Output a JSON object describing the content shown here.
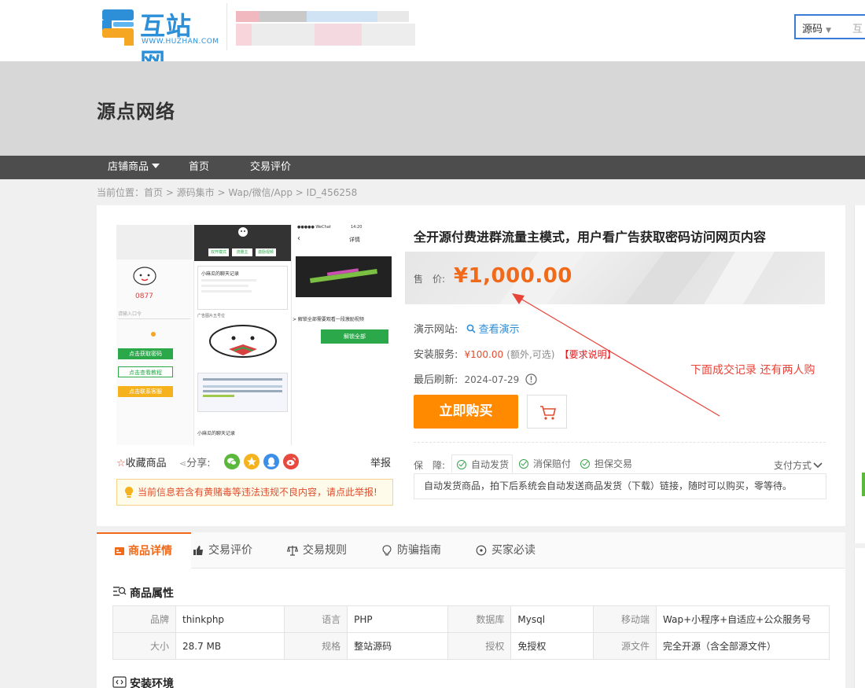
{
  "header": {
    "logo_text": "互站网",
    "logo_url": "WWW.HUZHAN.COM",
    "search_type": "源码",
    "search_placeholder": "互"
  },
  "shop": {
    "name": "源点网络"
  },
  "nav": [
    {
      "label": "店铺商品",
      "dropdown": true
    },
    {
      "label": "首页"
    },
    {
      "label": "交易评价"
    }
  ],
  "breadcrumb": "当前位置：首页 > 源码集市 > Wap/微信/App > ID_456258",
  "gallery": {
    "left_number": "0877",
    "left_hint": "请输入口令",
    "left_btn1": "点击获取密码",
    "left_btn2": "点击查看教程",
    "left_btn3": "点击联系客服",
    "mid_tab1": "双开模式",
    "mid_tab2": "流量主",
    "mid_tab3": "激励视频",
    "mid_list_title": "小麻瓜的聊天记录",
    "mid_caption": "广告图片五号位",
    "mid_footer": "小麻瓜的聊天记录",
    "right_status": "●●●●● WeChat",
    "right_time": "14:20",
    "right_title": "详情",
    "right_tip": "> 解锁全部需要观看一段激励视频",
    "right_btn": "解锁全部"
  },
  "actions": {
    "favorite": "收藏商品",
    "share": "分享:",
    "report": "举报"
  },
  "warning": "当前信息若含有黄赌毒等违法违规不良内容，请点此举报!",
  "product": {
    "title": "全开源付费进群流量主模式，用户看广告获取密码访问网页内容",
    "price_label": "售　价:",
    "price": "¥1,000.00",
    "demo_label": "演示网站:",
    "demo_link": "查看演示",
    "install_label": "安装服务:",
    "install_price": "¥100.00",
    "install_note": "(额外,可选)",
    "install_req": "【要求说明】",
    "refresh_label": "最后刷新:",
    "refresh_date": "2024-07-29",
    "buy_button": "立即购买",
    "guarantee_label": "保　障:",
    "guarantees": [
      "自动发货",
      "消保赔付",
      "担保交易"
    ],
    "pay_methods": "支付方式",
    "delivery_desc": "自动发货商品，拍下后系统会自动发送商品发货（下载）链接，随时可以购买，零等待。"
  },
  "annotation": "下面成交记录 还有两人购",
  "tabs": [
    {
      "label": "商品详情",
      "icon": "detail-icon"
    },
    {
      "label": "交易评价",
      "icon": "thumb-icon"
    },
    {
      "label": "交易规则",
      "icon": "scale-icon"
    },
    {
      "label": "防骗指南",
      "icon": "bulb-icon"
    },
    {
      "label": "买家必读",
      "icon": "info-icon"
    }
  ],
  "attributes": {
    "title": "商品属性",
    "rows": [
      [
        [
          "品牌",
          "thinkphp"
        ],
        [
          "语言",
          "PHP"
        ],
        [
          "数据库",
          "Mysql"
        ],
        [
          "移动端",
          "Wap+小程序+自适应+公众服务号"
        ]
      ],
      [
        [
          "大小",
          "28.7 MB"
        ],
        [
          "规格",
          "整站源码"
        ],
        [
          "授权",
          "免授权"
        ],
        [
          "源文件",
          "完全开源（含全部源文件）"
        ]
      ]
    ]
  },
  "env": {
    "title": "安装环境"
  },
  "colors": {
    "accent": "#f06a1a",
    "buy": "#ff8a00",
    "nav": "#4d4d4d",
    "link": "#2d8fd8"
  }
}
